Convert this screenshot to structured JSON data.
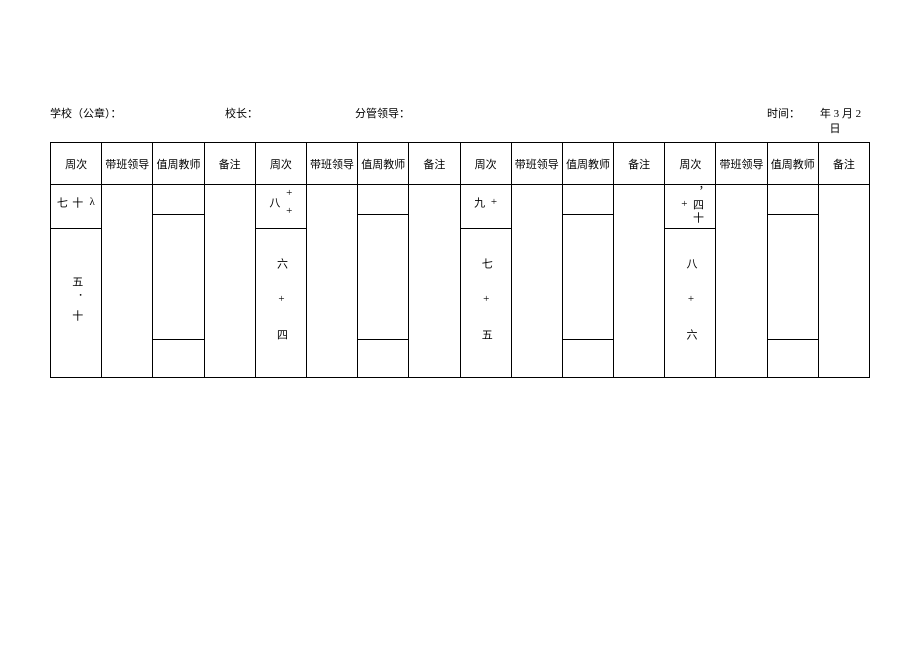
{
  "top": {
    "school_label": "学校（公章）：",
    "principal_label": "校长：",
    "branch_leader_label": "分管领导：",
    "time_label": "时间：",
    "date_main": "　年 3 月 2",
    "date_tail": "日"
  },
  "headers": {
    "week": "周次",
    "leader": "带班领导",
    "teacher": "值周教师",
    "note": "备注"
  },
  "groups": [
    {
      "week_top": "λ 十 七",
      "week_bottom": "五．十"
    },
    {
      "week_top": "++ 八",
      "week_bottom": "六 + 四"
    },
    {
      "week_top": "+  九",
      "week_bottom": "七 + 五"
    },
    {
      "week_top": "，四十   +",
      "week_bottom": "八 + 六"
    }
  ]
}
